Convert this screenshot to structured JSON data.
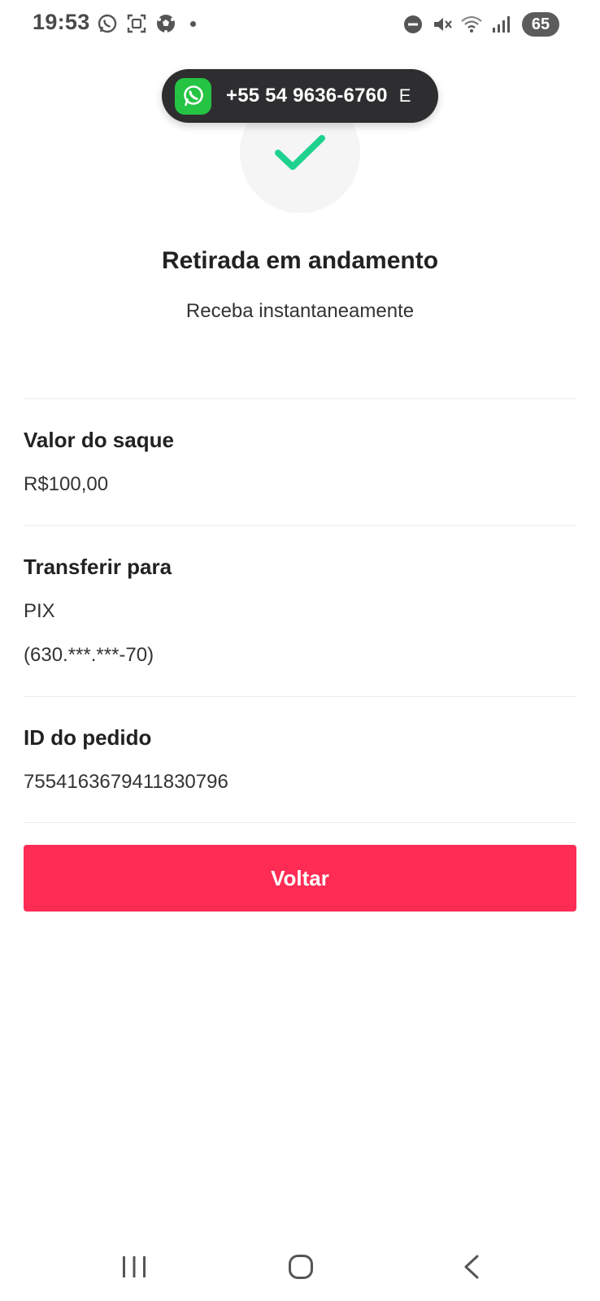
{
  "status_bar": {
    "time": "19:53",
    "left_icons": [
      "whatsapp-icon",
      "screenshot-icon",
      "soccer-ball-icon",
      "notification-dot-icon"
    ],
    "right_icons": [
      "do-not-disturb-icon",
      "muted-icon",
      "wifi-icon",
      "signal-icon"
    ],
    "battery": "65"
  },
  "call_pill": {
    "icon": "whatsapp-icon",
    "number": "+55 54 9636-6760",
    "extra": "E"
  },
  "status": {
    "icon": "check-icon",
    "title": "Retirada em andamento",
    "subtitle": "Receba instantaneamente"
  },
  "details": {
    "amount": {
      "label": "Valor do saque",
      "value": "R$100,00"
    },
    "transfer": {
      "label": "Transferir para",
      "method": "PIX",
      "account": "(630.***.***-70)"
    },
    "order": {
      "label": "ID do pedido",
      "value": "7554163679411830796"
    }
  },
  "actions": {
    "back_label": "Voltar"
  },
  "nav_bar": {
    "icons": [
      "recent-apps-icon",
      "home-icon",
      "back-icon"
    ]
  },
  "colors": {
    "accent": "#fe2c55",
    "check": "#1fd18f",
    "whatsapp": "#25c443"
  }
}
